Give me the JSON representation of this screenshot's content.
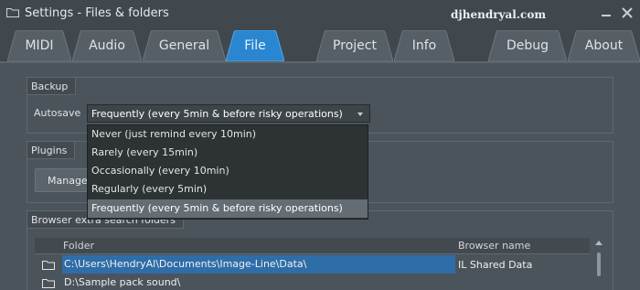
{
  "window": {
    "title": "Settings - Files & folders",
    "watermark": "djhendryal.com",
    "icons": [
      "folder-icon",
      "minimize-icon",
      "close-icon"
    ]
  },
  "tabs": [
    {
      "label": "MIDI",
      "active": false
    },
    {
      "label": "Audio",
      "active": false
    },
    {
      "label": "General",
      "active": false
    },
    {
      "label": "File",
      "active": true
    },
    {
      "label": "Project",
      "active": false
    },
    {
      "label": "Info",
      "active": false
    },
    {
      "label": "Debug",
      "active": false
    },
    {
      "label": "About",
      "active": false
    }
  ],
  "backup": {
    "group_title": "Backup",
    "autosave_label": "Autosave",
    "selected": "Frequently (every 5min & before risky operations)",
    "options": [
      "Never (just remind every 10min)",
      "Rarely (every 15min)",
      "Occasionally (every 10min)",
      "Regularly (every 5min)",
      "Frequently (every 5min & before risky operations)"
    ]
  },
  "plugins": {
    "group_title": "Plugins",
    "manage_label": "Manage"
  },
  "browser": {
    "group_title": "Browser extra search folders",
    "columns": {
      "folder": "Folder",
      "name": "Browser name"
    },
    "rows": [
      {
        "path": "C:\\Users\\HendryAl\\Documents\\Image-Line\\Data\\",
        "name": "IL Shared Data",
        "selected": true
      },
      {
        "path": "D:\\Sample pack sound\\",
        "name": "",
        "selected": false
      }
    ]
  },
  "colors": {
    "accent_tab": "#2a86d0",
    "selection": "#2f6da8",
    "background": "#4b545a"
  }
}
